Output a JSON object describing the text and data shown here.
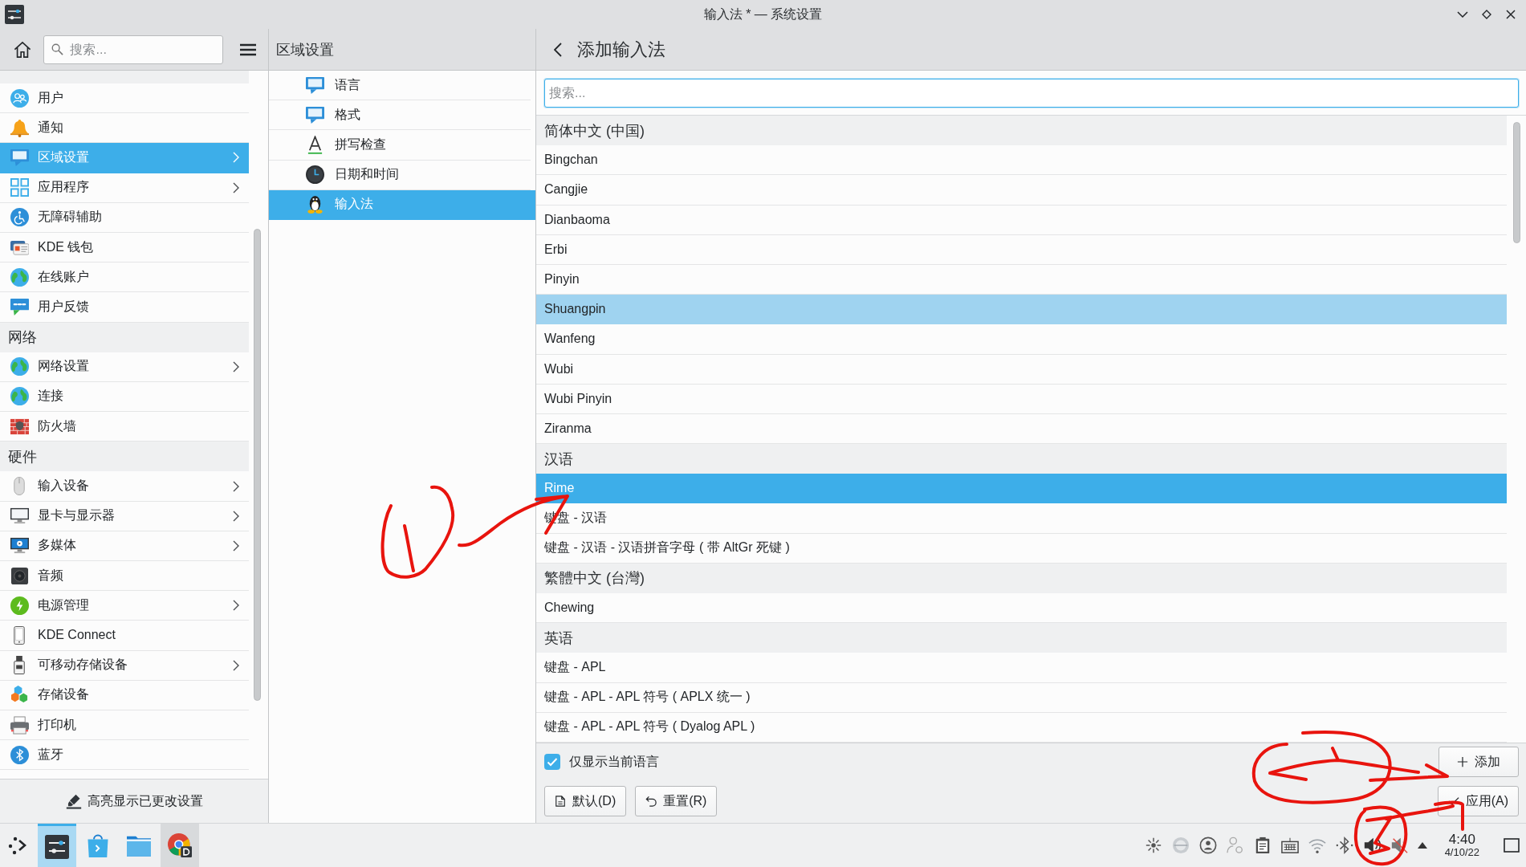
{
  "window": {
    "title": "输入法 * — 系统设置"
  },
  "sidebar": {
    "search": {
      "placeholder": "搜索..."
    },
    "sections": [
      {
        "items": [
          {
            "label": "用户",
            "has_submenu": false,
            "selected": false
          },
          {
            "label": "通知",
            "has_submenu": false,
            "selected": false
          },
          {
            "label": "区域设置",
            "has_submenu": true,
            "selected": true
          },
          {
            "label": "应用程序",
            "has_submenu": true,
            "selected": false
          },
          {
            "label": "无障碍辅助",
            "has_submenu": false,
            "selected": false
          },
          {
            "label": "KDE 钱包",
            "has_submenu": false,
            "selected": false
          },
          {
            "label": "在线账户",
            "has_submenu": false,
            "selected": false
          },
          {
            "label": "用户反馈",
            "has_submenu": false,
            "selected": false
          }
        ]
      },
      {
        "title": "网络",
        "items": [
          {
            "label": "网络设置",
            "has_submenu": true,
            "selected": false
          },
          {
            "label": "连接",
            "has_submenu": false,
            "selected": false
          },
          {
            "label": "防火墙",
            "has_submenu": false,
            "selected": false
          }
        ]
      },
      {
        "title": "硬件",
        "items": [
          {
            "label": "输入设备",
            "has_submenu": true,
            "selected": false
          },
          {
            "label": "显卡与显示器",
            "has_submenu": true,
            "selected": false
          },
          {
            "label": "多媒体",
            "has_submenu": true,
            "selected": false
          },
          {
            "label": "音频",
            "has_submenu": false,
            "selected": false
          },
          {
            "label": "电源管理",
            "has_submenu": true,
            "selected": false
          },
          {
            "label": "KDE Connect",
            "has_submenu": false,
            "selected": false
          },
          {
            "label": "可移动存储设备",
            "has_submenu": true,
            "selected": false
          },
          {
            "label": "存储设备",
            "has_submenu": false,
            "selected": false
          },
          {
            "label": "打印机",
            "has_submenu": false,
            "selected": false
          },
          {
            "label": "蓝牙",
            "has_submenu": false,
            "selected": false
          }
        ]
      }
    ],
    "footer_button": "高亮显示已更改设置"
  },
  "category_panel": {
    "title": "区域设置",
    "items": [
      {
        "label": "语言",
        "selected": false
      },
      {
        "label": "格式",
        "selected": false
      },
      {
        "label": "拼写检查",
        "selected": false
      },
      {
        "label": "日期和时间",
        "selected": false
      },
      {
        "label": "输入法",
        "selected": true
      }
    ]
  },
  "add_panel": {
    "title": "添加输入法",
    "search": {
      "placeholder": "搜索..."
    },
    "groups": [
      {
        "title": "简体中文 (中国)",
        "items": [
          {
            "label": "Bingchan",
            "selected": false,
            "hovered": false
          },
          {
            "label": "Cangjie",
            "selected": false,
            "hovered": false
          },
          {
            "label": "Dianbaoma",
            "selected": false,
            "hovered": false
          },
          {
            "label": "Erbi",
            "selected": false,
            "hovered": false
          },
          {
            "label": "Pinyin",
            "selected": false,
            "hovered": false
          },
          {
            "label": "Shuangpin",
            "selected": false,
            "hovered": true
          },
          {
            "label": "Wanfeng",
            "selected": false,
            "hovered": false
          },
          {
            "label": "Wubi",
            "selected": false,
            "hovered": false
          },
          {
            "label": "Wubi Pinyin",
            "selected": false,
            "hovered": false
          },
          {
            "label": "Ziranma",
            "selected": false,
            "hovered": false
          }
        ]
      },
      {
        "title": "汉语",
        "items": [
          {
            "label": "Rime",
            "selected": true,
            "hovered": false
          },
          {
            "label": "键盘 - 汉语",
            "selected": false,
            "hovered": false
          },
          {
            "label": "键盘 - 汉语 - 汉语拼音字母 ( 带 AltGr 死键 )",
            "selected": false,
            "hovered": false
          }
        ]
      },
      {
        "title": "繁體中文 (台灣)",
        "items": [
          {
            "label": "Chewing",
            "selected": false,
            "hovered": false
          }
        ]
      },
      {
        "title": "英语",
        "items": [
          {
            "label": "键盘 - APL",
            "selected": false,
            "hovered": false
          },
          {
            "label": "键盘 - APL - APL 符号 ( APLX 统一 )",
            "selected": false,
            "hovered": false
          },
          {
            "label": "键盘 - APL - APL 符号 ( Dyalog APL )",
            "selected": false,
            "hovered": false
          }
        ]
      }
    ],
    "only_current_language": {
      "label": "仅显示当前语言",
      "checked": true
    },
    "defaults_button": "默认(D)",
    "reset_button": "重置(R)",
    "add_button": "添加",
    "apply_button": "应用(A)"
  },
  "taskbar": {
    "tasks": [
      {
        "selected": true,
        "hovered": false
      },
      {
        "selected": false,
        "hovered": false
      },
      {
        "selected": false,
        "hovered": false
      },
      {
        "selected": false,
        "hovered": true
      }
    ],
    "time": "4:40",
    "date": "4/10/22"
  },
  "annotations": [
    {
      "kind": "circled-one"
    },
    {
      "kind": "arrow"
    },
    {
      "kind": "loop-arrow"
    },
    {
      "kind": "circled-three"
    }
  ]
}
